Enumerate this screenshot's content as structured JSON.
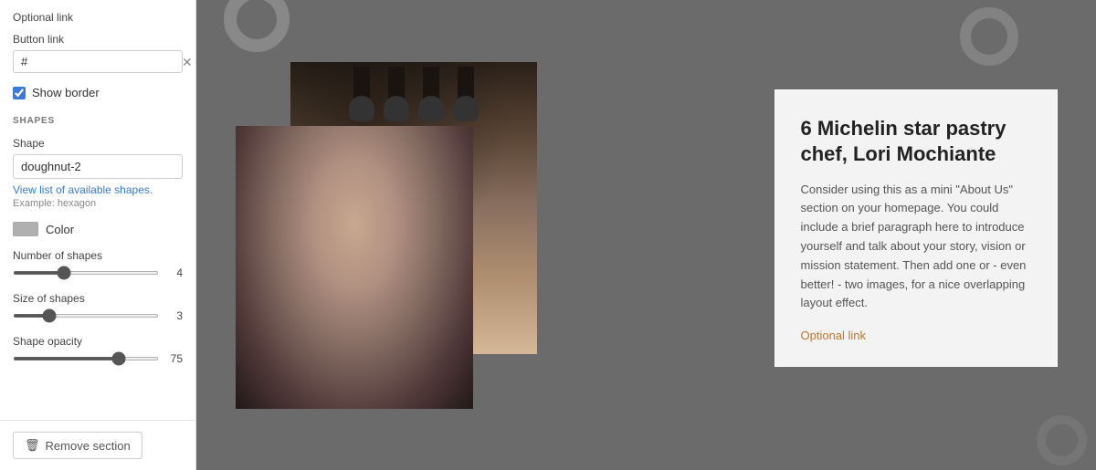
{
  "panel": {
    "optional_link_label": "Optional link",
    "button_link_label": "Button link",
    "button_link_value": "#",
    "show_border_label": "Show border",
    "show_border_checked": true,
    "shapes_section_title": "SHAPES",
    "shape_label": "Shape",
    "shape_value": "doughnut-2",
    "view_shapes_link": "View list of available shapes.",
    "shape_example": "Example: hexagon",
    "color_label": "Color",
    "num_shapes_label": "Number of shapes",
    "num_shapes_value": "4",
    "size_shapes_label": "Size of shapes",
    "size_shapes_value": "3",
    "shape_opacity_label": "Shape opacity",
    "shape_opacity_value": "75",
    "remove_section_label": "Remove section"
  },
  "preview": {
    "card_title": "6 Michelin star pastry chef, Lori Mochiante",
    "card_body": "Consider using this as a mini \"About Us\" section on your homepage. You could include a brief paragraph here to introduce yourself and talk about your story, vision or mission statement. Then add one or - even better! - two images, for a nice overlapping layout effect.",
    "optional_link": "Optional link"
  }
}
